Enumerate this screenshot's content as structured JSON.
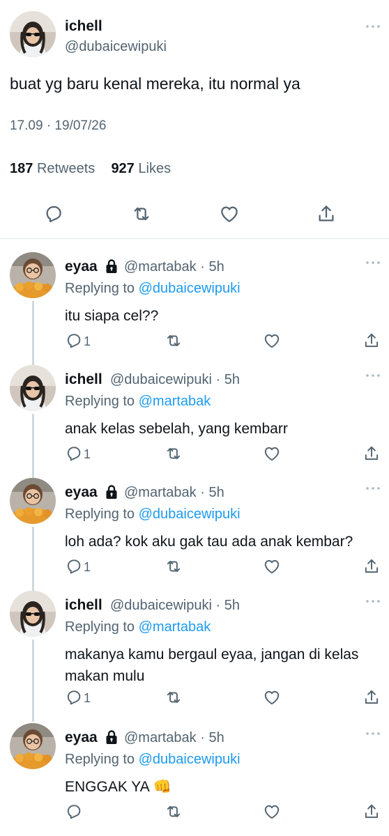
{
  "main_tweet": {
    "name": "ichell",
    "handle": "@dubaicewipuki",
    "text": "buat yg baru kenal mereka, itu normal ya",
    "timestamp": "17.09 · 19/07/26",
    "retweets_count": "187",
    "retweets_label": "Retweets",
    "likes_count": "927",
    "likes_label": "Likes",
    "icons": [
      "reply-icon",
      "retweet-icon",
      "like-icon",
      "share-icon"
    ]
  },
  "replies": [
    {
      "name": "eyaa",
      "locked": true,
      "handle": "@martabak",
      "time": "· 5h",
      "replying_prefix": "Replying to",
      "replying_to": "@dubaicewipuki",
      "text": "itu siapa cel??",
      "reply_count": "1"
    },
    {
      "name": "ichell",
      "locked": false,
      "handle": "@dubaicewipuki",
      "time": "· 5h",
      "replying_prefix": "Replying to",
      "replying_to": "@martabak",
      "text": "anak kelas sebelah, yang kembarr",
      "reply_count": "1"
    },
    {
      "name": "eyaa",
      "locked": true,
      "handle": "@martabak",
      "time": "· 5h",
      "replying_prefix": "Replying to",
      "replying_to": "@dubaicewipuki",
      "text": "loh ada? kok aku gak tau ada anak kembar?",
      "reply_count": "1"
    },
    {
      "name": "ichell",
      "locked": false,
      "handle": "@dubaicewipuki",
      "time": "· 5h",
      "replying_prefix": "Replying to",
      "replying_to": "@martabak",
      "text_line1": "makanya kamu bergaul eyaa, jangan di kelas",
      "text_line2": "makan mulu",
      "reply_count": "1"
    },
    {
      "name": "eyaa",
      "locked": true,
      "handle": "@martabak",
      "time": "· 5h",
      "replying_prefix": "Replying to",
      "replying_to": "@dubaicewipuki",
      "text": "ENGGAK YA",
      "emoji": "👊",
      "reply_count": ""
    }
  ],
  "colors": {
    "link": "#1d9bf0",
    "muted": "#536471",
    "text": "#0f1419",
    "thread_line": "#cfd9de"
  }
}
